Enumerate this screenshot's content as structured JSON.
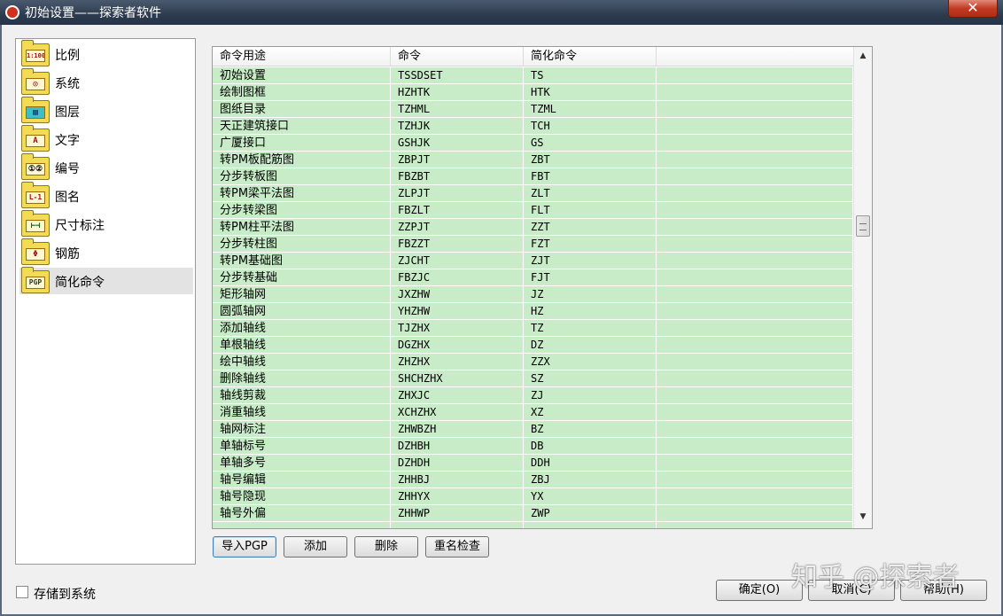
{
  "window": {
    "title": "初始设置——探索者软件",
    "close_symbol": "✕"
  },
  "sidebar": {
    "items": [
      {
        "label": "比例",
        "icon": "scale-icon",
        "glyph": "1:100"
      },
      {
        "label": "系统",
        "icon": "system-icon",
        "glyph": "◎"
      },
      {
        "label": "图层",
        "icon": "layer-icon",
        "glyph": "▤"
      },
      {
        "label": "文字",
        "icon": "text-icon",
        "glyph": "A"
      },
      {
        "label": "编号",
        "icon": "numbering-icon",
        "glyph": "①②"
      },
      {
        "label": "图名",
        "icon": "drawing-name-icon",
        "glyph": "L-1"
      },
      {
        "label": "尺寸标注",
        "icon": "dimension-icon",
        "glyph": "⊢⊣"
      },
      {
        "label": "钢筋",
        "icon": "rebar-icon",
        "glyph": "Φ"
      },
      {
        "label": "简化命令",
        "icon": "shortcut-icon",
        "glyph": "PGP"
      }
    ],
    "selected": "简化命令"
  },
  "grid": {
    "columns": [
      "命令用途",
      "命令",
      "简化命令",
      ""
    ],
    "rows": [
      [
        "初始设置",
        "TSSDSET",
        "TS"
      ],
      [
        "绘制图框",
        "HZHTK",
        "HTK"
      ],
      [
        "图纸目录",
        "TZHML",
        "TZML"
      ],
      [
        "天正建筑接口",
        "TZHJK",
        "TCH"
      ],
      [
        "广厦接口",
        "GSHJK",
        "GS"
      ],
      [
        "转PM板配筋图",
        "ZBPJT",
        "ZBT"
      ],
      [
        "分步转板图",
        "FBZBT",
        "FBT"
      ],
      [
        "转PM梁平法图",
        "ZLPJT",
        "ZLT"
      ],
      [
        "分步转梁图",
        "FBZLT",
        "FLT"
      ],
      [
        "转PM柱平法图",
        "ZZPJT",
        "ZZT"
      ],
      [
        "分步转柱图",
        "FBZZT",
        "FZT"
      ],
      [
        "转PM基础图",
        "ZJCHT",
        "ZJT"
      ],
      [
        "分步转基础",
        "FBZJC",
        "FJT"
      ],
      [
        "矩形轴网",
        "JXZHW",
        "JZ"
      ],
      [
        "圆弧轴网",
        "YHZHW",
        "HZ"
      ],
      [
        "添加轴线",
        "TJZHX",
        "TZ"
      ],
      [
        "单根轴线",
        "DGZHX",
        "DZ"
      ],
      [
        "绘中轴线",
        "ZHZHX",
        "ZZX"
      ],
      [
        "删除轴线",
        "SHCHZHX",
        "SZ"
      ],
      [
        "轴线剪裁",
        "ZHXJC",
        "ZJ"
      ],
      [
        "消重轴线",
        "XCHZHX",
        "XZ"
      ],
      [
        "轴网标注",
        "ZHWBZH",
        "BZ"
      ],
      [
        "单轴标号",
        "DZHBH",
        "DB"
      ],
      [
        "单轴多号",
        "DZHDH",
        "DDH"
      ],
      [
        "轴号编辑",
        "ZHHBJ",
        "ZBJ"
      ],
      [
        "轴号隐现",
        "ZHHYX",
        "YX"
      ],
      [
        "轴号外偏",
        "ZHHWP",
        "ZWP"
      ],
      [
        "",
        "",
        ""
      ]
    ]
  },
  "scrollbar": {
    "up": "▲",
    "down": "▼"
  },
  "buttons": {
    "import": "导入PGP",
    "add": "添加",
    "delete": "删除",
    "rename_check": "重名检查",
    "ok": "确定(O)",
    "cancel": "取消(C)",
    "help": "帮助(H)"
  },
  "save_to_system": {
    "label": "存储到系统",
    "checked": false
  },
  "watermark": "知乎 @探索者"
}
